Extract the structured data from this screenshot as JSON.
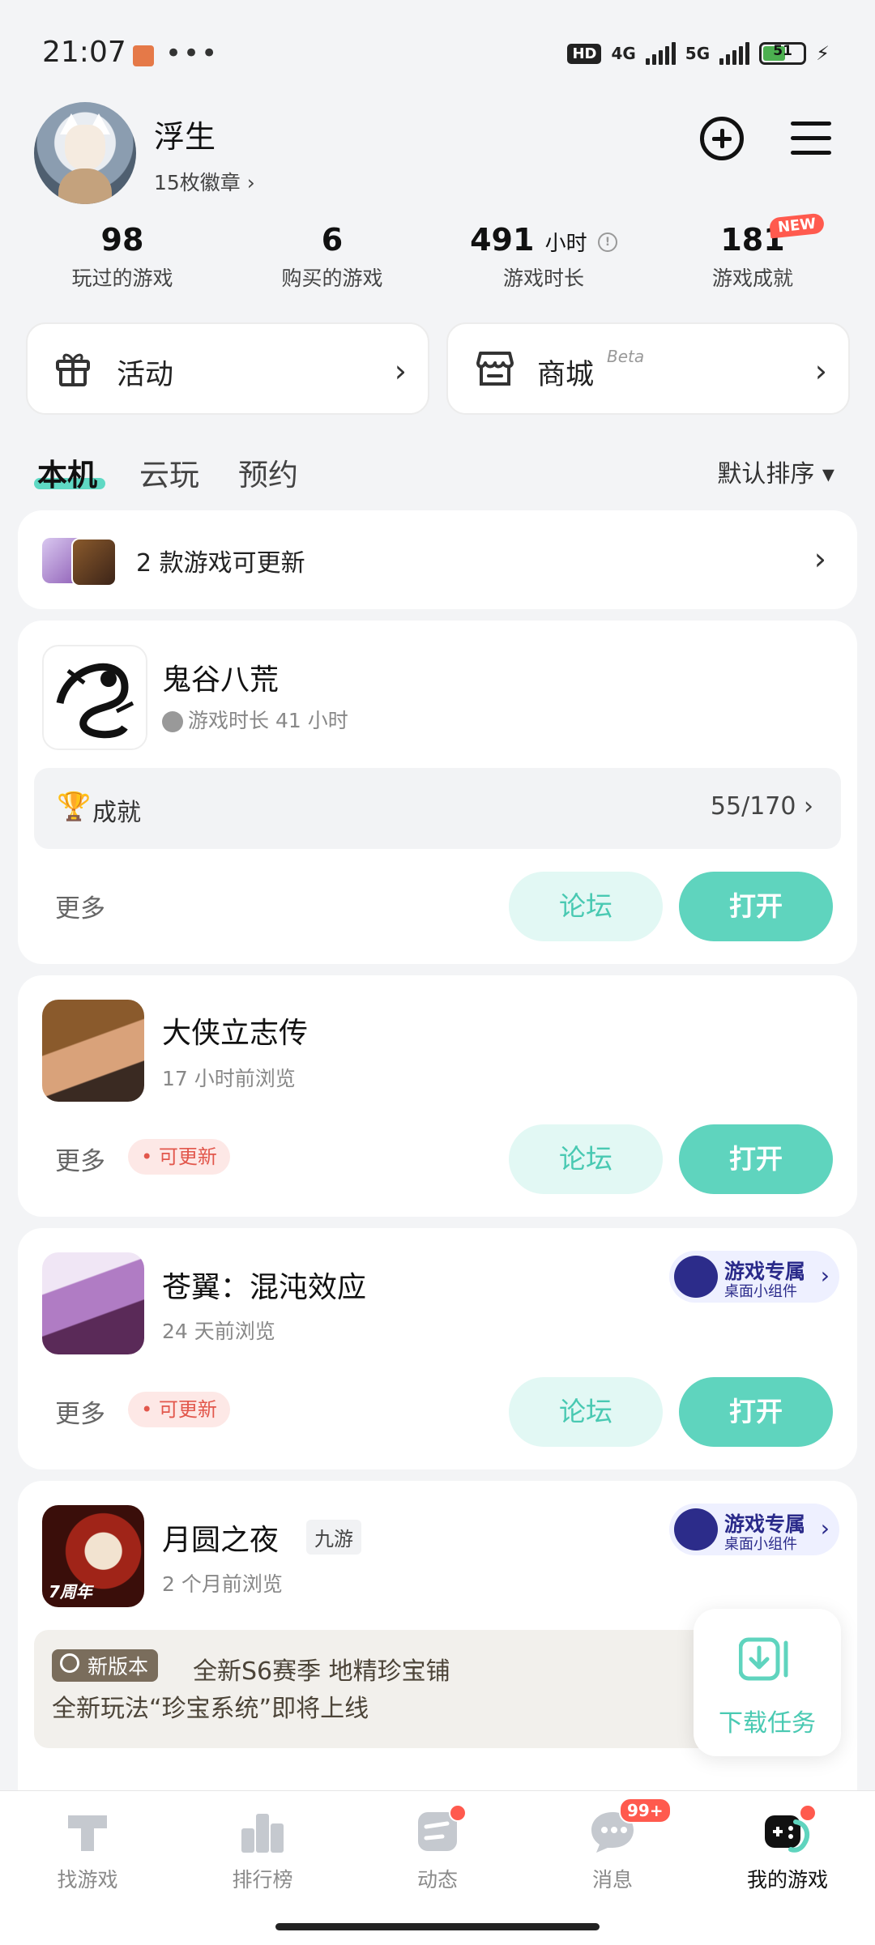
{
  "status": {
    "time": "21:07",
    "dots": "•••",
    "hd": "HD",
    "net1": "4G",
    "net2": "5G",
    "battery": "51"
  },
  "profile": {
    "name": "浮生",
    "badges": "15枚徽章 ›"
  },
  "stats": [
    {
      "value": "98",
      "label": "玩过的游戏"
    },
    {
      "value": "6",
      "label": "购买的游戏"
    },
    {
      "value": "491",
      "unit": "小时",
      "label": "游戏时长"
    },
    {
      "value": "181",
      "label": "游戏成就",
      "badge": "NEW"
    }
  ],
  "entries": {
    "activity": "活动",
    "store": "商城",
    "store_tag": "Beta"
  },
  "tabs": {
    "local": "本机",
    "cloud": "云玩",
    "reserve": "预约",
    "sort": "默认排序 ▾"
  },
  "update_row": {
    "text": "2 款游戏可更新"
  },
  "games": [
    {
      "title": "鬼谷八荒",
      "sub": "游戏时长 41 小时",
      "achievement_label": "成就",
      "achievement_count": "55/170 ›",
      "more": "更多",
      "forum": "论坛",
      "open": "打开"
    },
    {
      "title": "大侠立志传",
      "sub": "17 小时前浏览",
      "more": "更多",
      "update": "• 可更新",
      "forum": "论坛",
      "open": "打开"
    },
    {
      "title": "苍翼：混沌效应",
      "sub": "24 天前浏览",
      "more": "更多",
      "update": "• 可更新",
      "forum": "论坛",
      "open": "打开",
      "widget_t1": "游戏专属",
      "widget_t2": "桌面小组件"
    },
    {
      "title": "月圆之夜",
      "tag": "九游",
      "sub": "2 个月前浏览",
      "widget_t1": "游戏专属",
      "widget_t2": "桌面小组件",
      "icon_caption": "7周年",
      "news_tag": "新版本",
      "news_line1": "全新S6赛季 地精珍宝铺",
      "news_line2": "全新玩法“珍宝系统”即将上线"
    }
  ],
  "download": {
    "label": "下载任务"
  },
  "nav": [
    {
      "label": "找游戏"
    },
    {
      "label": "排行榜"
    },
    {
      "label": "动态"
    },
    {
      "label": "消息",
      "count": "99+"
    },
    {
      "label": "我的游戏"
    }
  ],
  "colors": {
    "accent": "#5fd4be",
    "accent_light": "#e2f8f4",
    "badge_red": "#ff5a4e"
  }
}
